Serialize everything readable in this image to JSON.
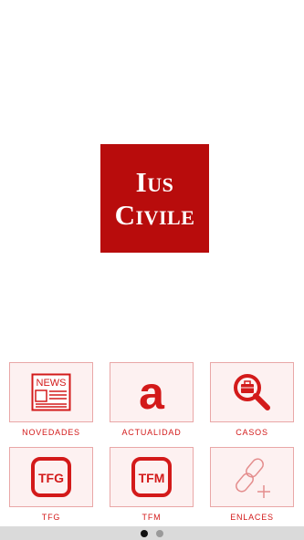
{
  "logo": {
    "line1": "Ius",
    "line2": "Civile"
  },
  "colors": {
    "brand": "#b80c0c",
    "accent": "#d31a1a",
    "tile_border": "#e9a7a7"
  },
  "tiles": [
    {
      "label": "NOVEDADES",
      "icon": "newspaper-icon",
      "icon_text": "NEWS"
    },
    {
      "label": "ACTUALIDAD",
      "icon": "letter-a-icon",
      "icon_text": "a"
    },
    {
      "label": "CASOS",
      "icon": "briefcase-search-icon"
    },
    {
      "label": "TFG",
      "icon": "tfg-badge-icon",
      "icon_text": "TFG"
    },
    {
      "label": "TFM",
      "icon": "tfm-badge-icon",
      "icon_text": "TFM"
    },
    {
      "label": "ENLACES",
      "icon": "link-add-icon"
    }
  ],
  "pager": {
    "pages": 2,
    "active": 1
  }
}
